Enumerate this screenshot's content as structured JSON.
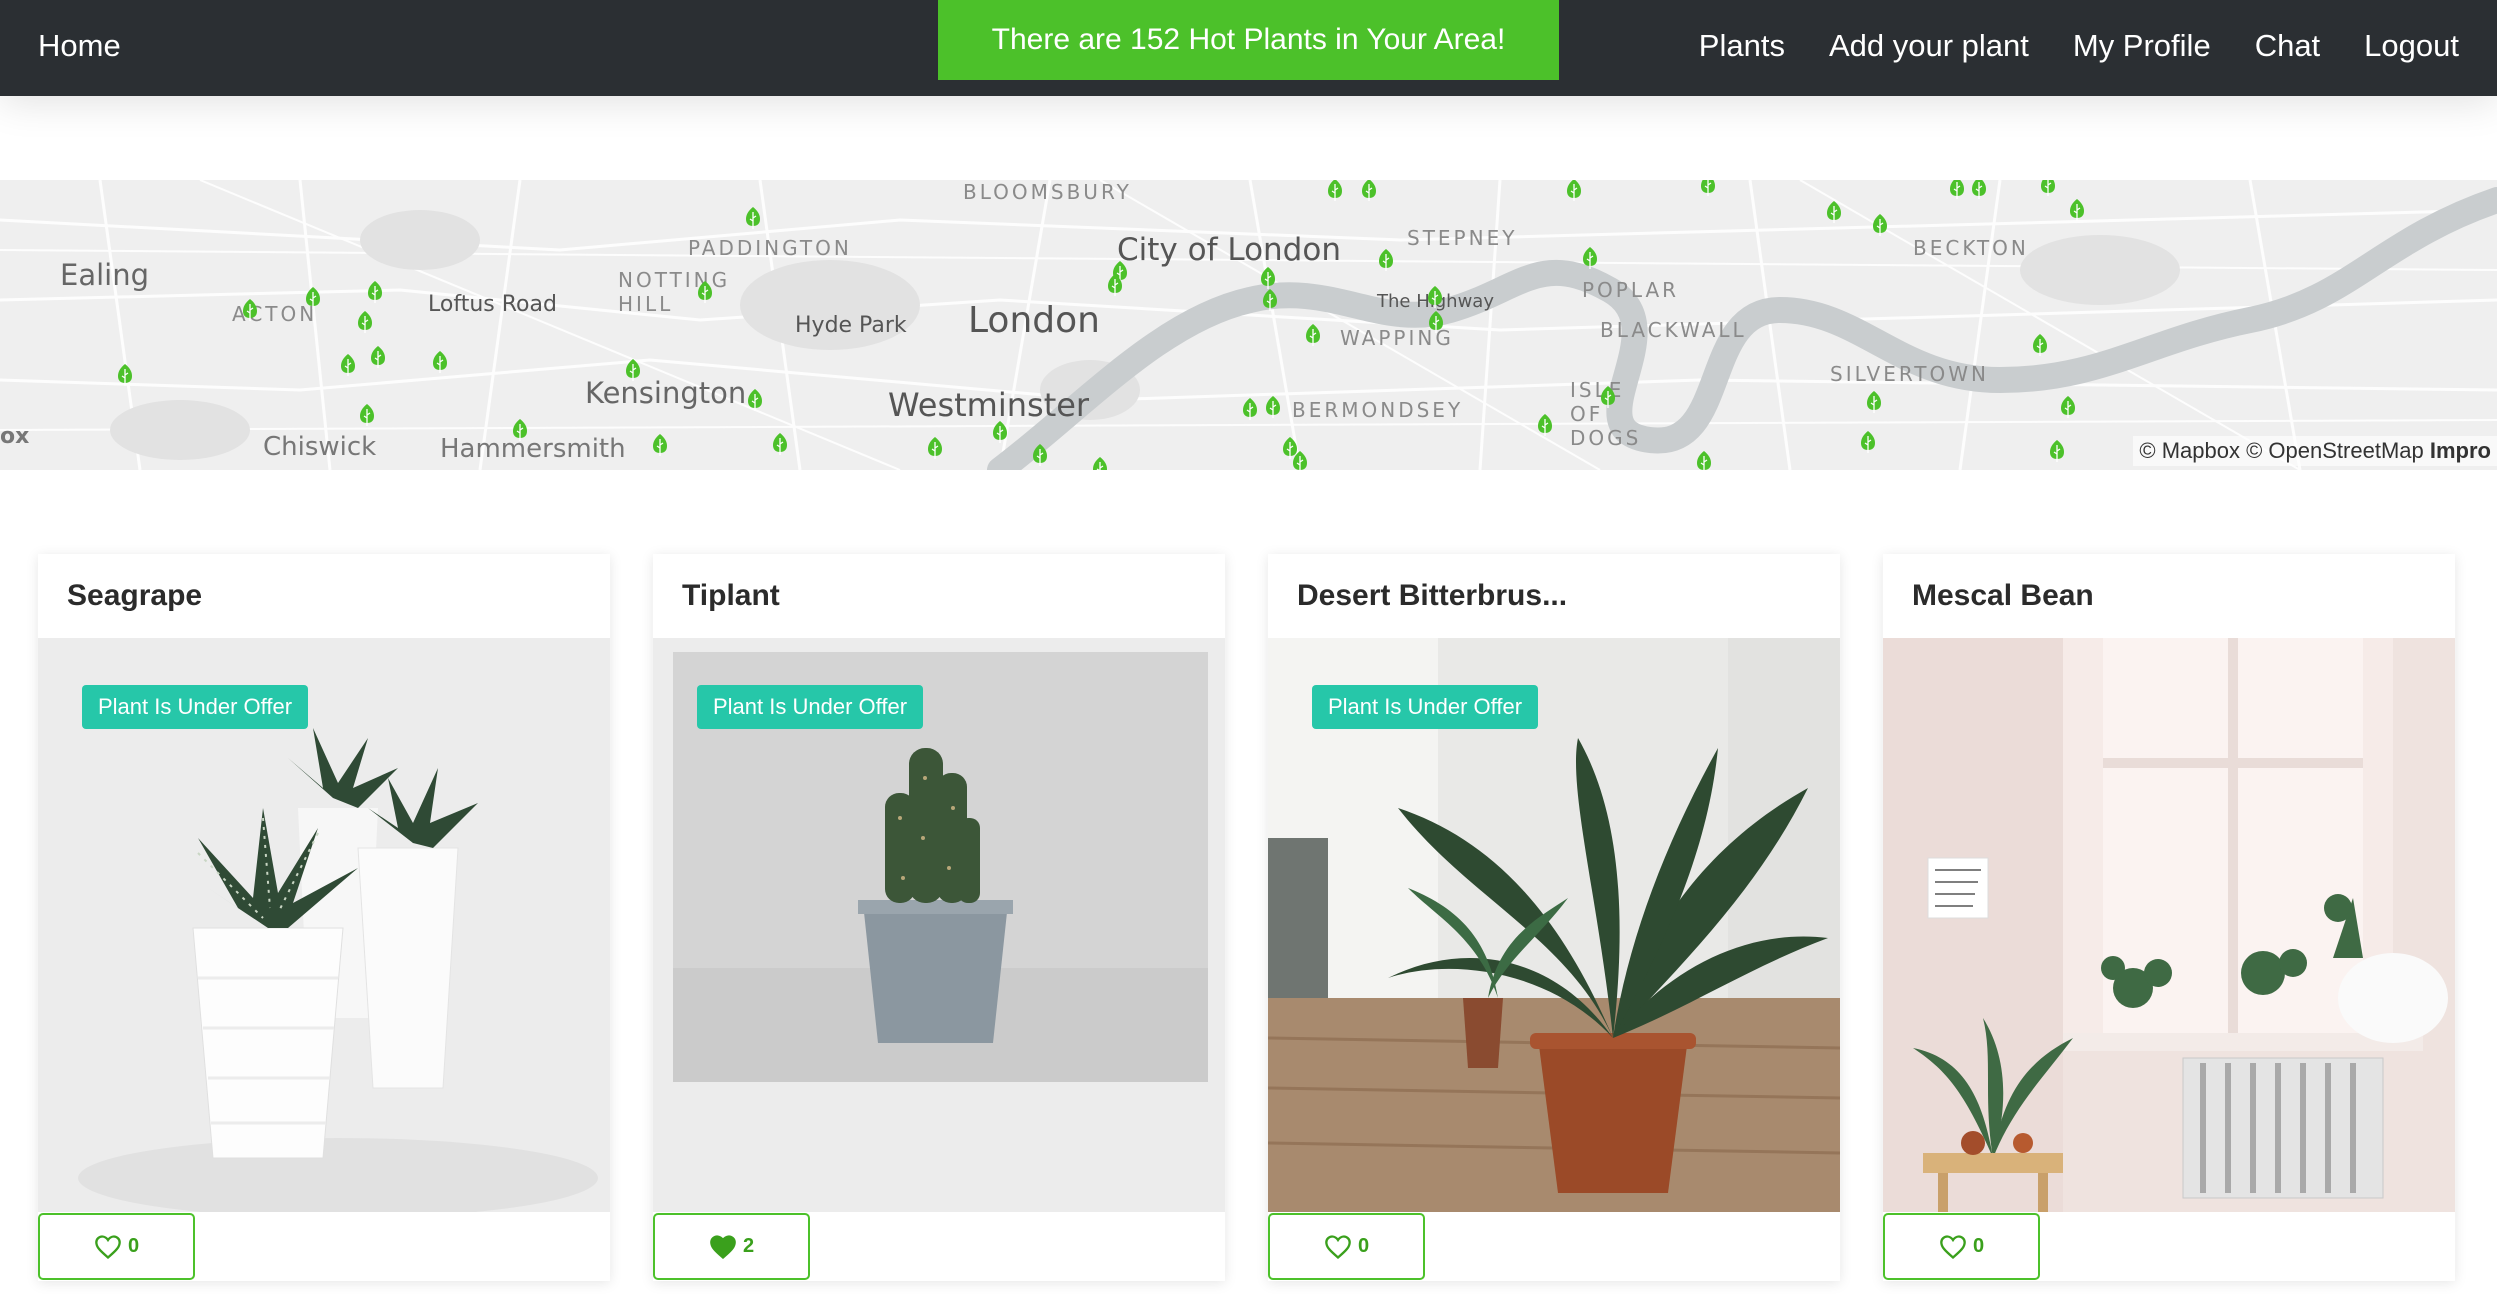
{
  "nav": {
    "home": "Home",
    "links": [
      "Plants",
      "Add your plant",
      "My Profile",
      "Chat",
      "Logout"
    ]
  },
  "banner": "There are 152 Hot Plants in Your Area!",
  "map": {
    "labels": [
      "Ealing",
      "ACTON",
      "Loftus Road",
      "NOTTING HILL",
      "PADDINGTON",
      "Hyde Park",
      "London",
      "City of London",
      "Kensington",
      "Westminster",
      "Chiswick",
      "Hammersmith",
      "BLOOMSBURY",
      "STEPNEY",
      "The Highway",
      "WAPPING",
      "BERMONDSEY",
      "POPLAR",
      "BLACKWALL",
      "ISLE OF DOGS",
      "BECKTON",
      "SILVERTOWN",
      "ox"
    ],
    "attribution": "© Mapbox © OpenStreetMap",
    "attribution_link": "Impro",
    "pin_color": "#4cc12a"
  },
  "cards": [
    {
      "title": "Seagrape",
      "badge": "Plant Is Under Offer",
      "likes": "0",
      "liked": false
    },
    {
      "title": "Tiplant",
      "badge": "Plant Is Under Offer",
      "likes": "2",
      "liked": true
    },
    {
      "title": "Desert Bitterbrus...",
      "badge": "Plant Is Under Offer",
      "likes": "0",
      "liked": false
    },
    {
      "title": "Mescal Bean",
      "badge": "",
      "likes": "0",
      "liked": false
    }
  ],
  "colors": {
    "accent": "#4cc12a",
    "badge": "#26c7a9",
    "navbar": "#2b2f33"
  }
}
